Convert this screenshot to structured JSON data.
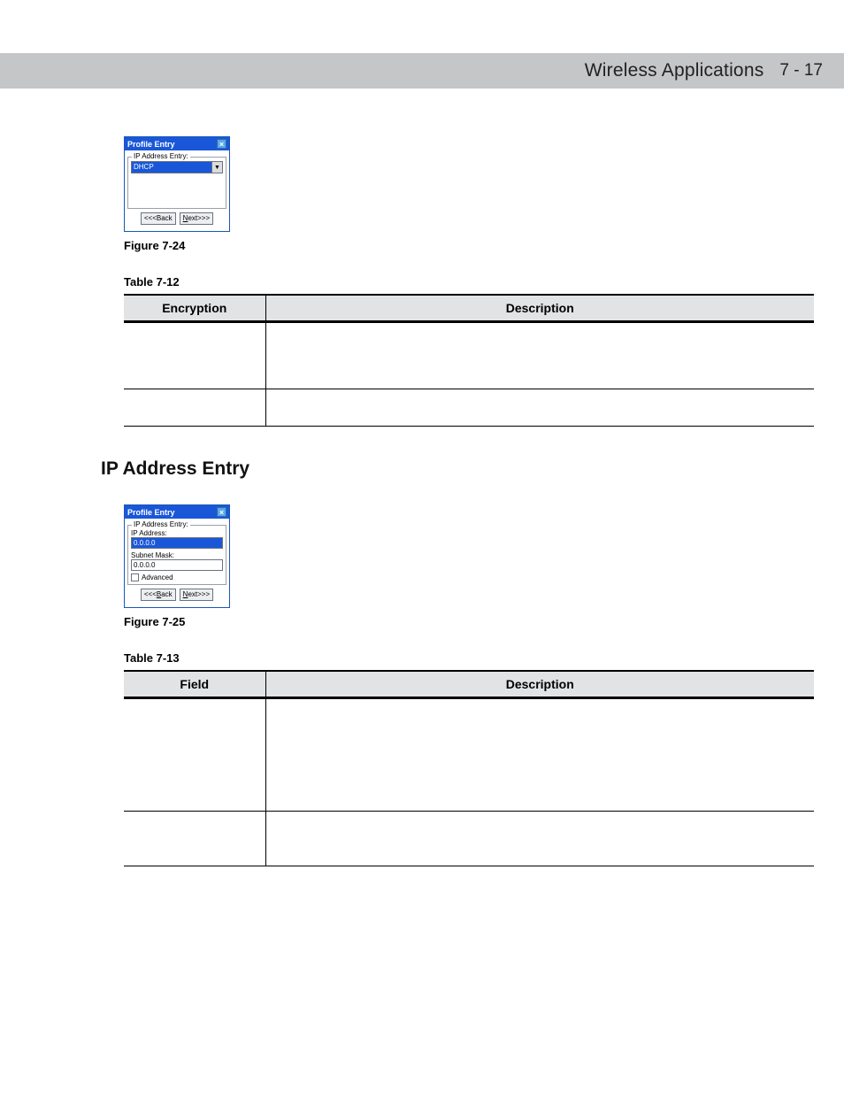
{
  "header": {
    "title": "Wireless Applications",
    "page": "7 - 17"
  },
  "fig24": {
    "window_title": "Profile Entry",
    "group_legend": "IP Address Entry:",
    "select_value": "DHCP",
    "back_label": "<<<Back",
    "next_pre": "N",
    "next_rest": "ext>>>",
    "caption": "Figure 7-24"
  },
  "table12": {
    "caption": "Table 7-12",
    "col_left": "Encryption",
    "col_right": "Description"
  },
  "section_heading": "IP Address Entry",
  "fig25": {
    "window_title": "Profile Entry",
    "group_legend": "IP Address Entry:",
    "ip_label": "IP Address:",
    "ip_value": "0.0.0.0",
    "mask_label": "Subnet Mask:",
    "mask_value": "0.0.0.0",
    "advanced_label": "Advanced",
    "back_pre": "<<<",
    "back_u": "B",
    "back_rest": "ack",
    "next_pre": "N",
    "next_rest": "ext>>>",
    "caption": "Figure 7-25"
  },
  "table13": {
    "caption": "Table 7-13",
    "col_left": "Field",
    "col_right": "Description"
  }
}
